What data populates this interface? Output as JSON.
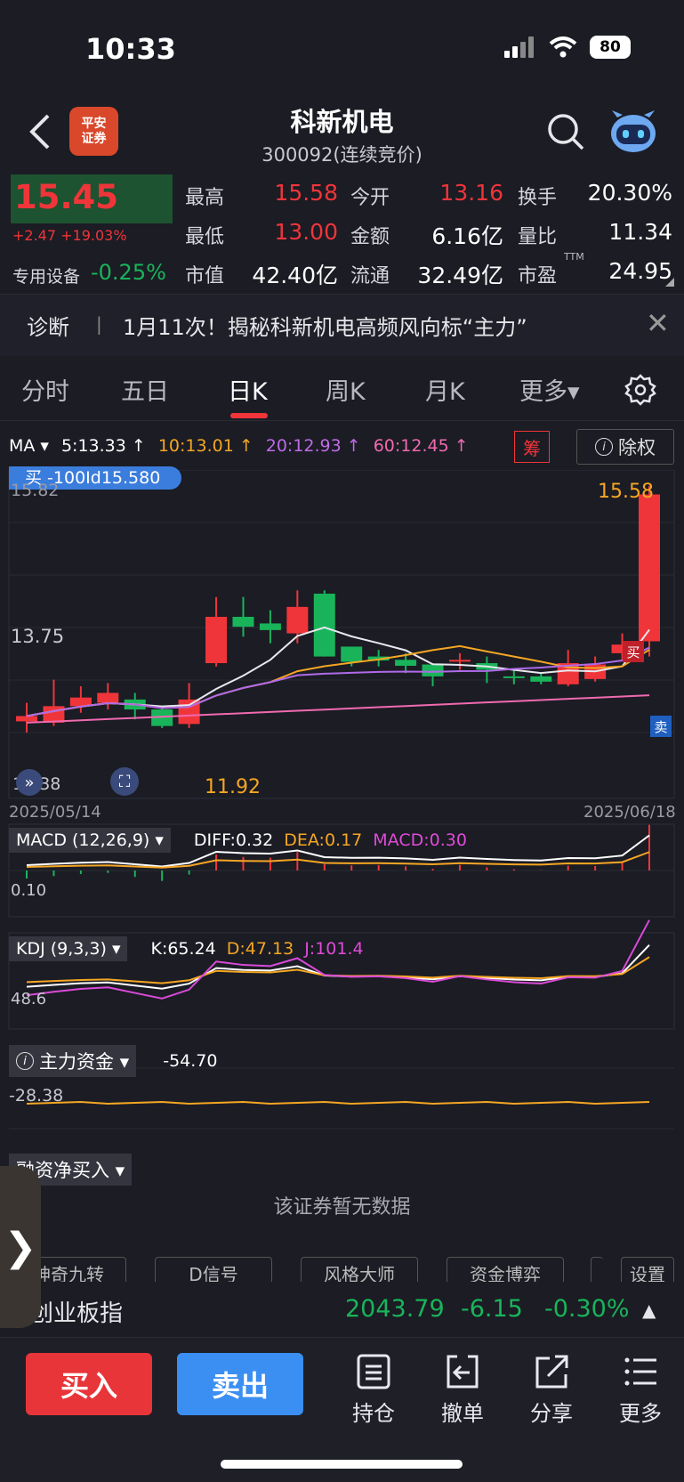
{
  "status": {
    "time": "10:33",
    "battery": "80"
  },
  "header": {
    "broker_logo_line1": "平安",
    "broker_logo_line2": "证券",
    "stock_name": "科新机电",
    "stock_code": "300092(连续竞价)"
  },
  "quote": {
    "price": "15.45",
    "change": "+2.47 +19.03%",
    "sector": "专用设备",
    "sector_change": "-0.25%",
    "fields": [
      {
        "label": "最高",
        "value": "15.58",
        "color": "red"
      },
      {
        "label": "今开",
        "value": "13.16",
        "color": "red"
      },
      {
        "label": "换手",
        "value": "20.30%",
        "color": "white"
      },
      {
        "label": "最低",
        "value": "13.00",
        "color": "red"
      },
      {
        "label": "金额",
        "value": "6.16亿",
        "color": "white"
      },
      {
        "label": "量比",
        "value": "11.34",
        "color": "white"
      },
      {
        "label": "市值",
        "value": "42.40亿",
        "color": "white"
      },
      {
        "label": "流通",
        "value": "32.49亿",
        "color": "white"
      },
      {
        "label": "市盈",
        "value": "24.95",
        "color": "white"
      }
    ],
    "ttm": "TTM"
  },
  "diagnosis": {
    "label": "诊断",
    "separator": "|",
    "text": "1月11次！揭秘科新机电高频风向标“主力”",
    "close": "✕"
  },
  "tabs": [
    "分时",
    "五日",
    "日K",
    "周K",
    "月K",
    "更多▾"
  ],
  "active_tab": "日K",
  "ma_legend": {
    "label": "MA ▾",
    "ma5": "5:13.33 ↑",
    "ma10": "10:13.01 ↑",
    "ma20": "20:12.93 ↑",
    "ma60": "60:12.45 ↑",
    "chou": "筹",
    "chuquan": "除权"
  },
  "kline": {
    "top_label": "买 -100Id15.580",
    "ytop": "15.82",
    "ymid": "13.75",
    "ybottom": "11.38",
    "high_label": "15.58",
    "low_label": "11.92",
    "buy_tag": "买",
    "sell_tag": "卖",
    "date_start": "2025/05/14",
    "date_end": "2025/06/18",
    "candles": [
      {
        "o": 12.02,
        "c": 12.1,
        "h": 12.3,
        "l": 11.85
      },
      {
        "o": 12.0,
        "c": 12.25,
        "h": 12.65,
        "l": 11.95
      },
      {
        "o": 12.25,
        "c": 12.38,
        "h": 12.55,
        "l": 12.15
      },
      {
        "o": 12.3,
        "c": 12.45,
        "h": 12.6,
        "l": 12.2
      },
      {
        "o": 12.35,
        "c": 12.2,
        "h": 12.45,
        "l": 12.05
      },
      {
        "o": 12.2,
        "c": 11.95,
        "h": 12.25,
        "l": 11.92
      },
      {
        "o": 11.98,
        "c": 12.35,
        "h": 12.6,
        "l": 11.92
      },
      {
        "o": 12.9,
        "c": 13.6,
        "h": 13.9,
        "l": 12.85
      },
      {
        "o": 13.6,
        "c": 13.45,
        "h": 13.9,
        "l": 13.3
      },
      {
        "o": 13.5,
        "c": 13.4,
        "h": 13.7,
        "l": 13.2
      },
      {
        "o": 13.35,
        "c": 13.75,
        "h": 14.0,
        "l": 13.2
      },
      {
        "o": 13.95,
        "c": 13.0,
        "h": 14.0,
        "l": 13.0
      },
      {
        "o": 13.15,
        "c": 12.92,
        "h": 13.15,
        "l": 12.85
      },
      {
        "o": 13.0,
        "c": 12.94,
        "h": 13.1,
        "l": 12.85
      },
      {
        "o": 12.95,
        "c": 12.86,
        "h": 13.05,
        "l": 12.75
      },
      {
        "o": 12.88,
        "c": 12.7,
        "h": 12.9,
        "l": 12.55
      },
      {
        "o": 12.95,
        "c": 12.95,
        "h": 13.05,
        "l": 12.8
      },
      {
        "o": 12.9,
        "c": 12.8,
        "h": 13.0,
        "l": 12.6
      },
      {
        "o": 12.7,
        "c": 12.68,
        "h": 12.8,
        "l": 12.58
      },
      {
        "o": 12.7,
        "c": 12.62,
        "h": 12.75,
        "l": 12.58
      },
      {
        "o": 12.58,
        "c": 12.9,
        "h": 13.1,
        "l": 12.55
      },
      {
        "o": 12.66,
        "c": 12.88,
        "h": 13.0,
        "l": 12.62
      },
      {
        "o": 13.05,
        "c": 13.18,
        "h": 13.35,
        "l": 12.95
      },
      {
        "o": 13.23,
        "c": 15.45,
        "h": 15.58,
        "l": 13.0
      }
    ]
  },
  "macd": {
    "label": "MACD (12,26,9) ▾",
    "diff": "DIFF:0.32",
    "dea": "DEA:0.17",
    "macd": "MACD:0.30",
    "ylabel": "0.10"
  },
  "kdj": {
    "label": "KDJ (9,3,3) ▾",
    "k": "K:65.24",
    "d": "D:47.13",
    "j": "J:101.4",
    "ylabel": "48.6"
  },
  "main_fund": {
    "label": "主力资金 ▾",
    "value": "-54.70",
    "ylabel": "-28.38"
  },
  "margin": {
    "label": "融资净买入 ▾",
    "empty": "该证券暂无数据"
  },
  "pills": [
    "神奇九转",
    "D信号",
    "风格大师",
    "资金博弈",
    "",
    "设置"
  ],
  "index": {
    "name": "创业板指",
    "value": "2043.79",
    "change": "-6.15",
    "pct": "-0.30%",
    "arrow": "▲"
  },
  "bottom": {
    "buy": "买入",
    "sell": "卖出",
    "nav": [
      "持仓",
      "撤单",
      "分享",
      "更多"
    ]
  },
  "side_handle": "❯",
  "colors": {
    "up": "#f0353a",
    "down": "#19b45a",
    "accent": "#3b8ff2"
  }
}
